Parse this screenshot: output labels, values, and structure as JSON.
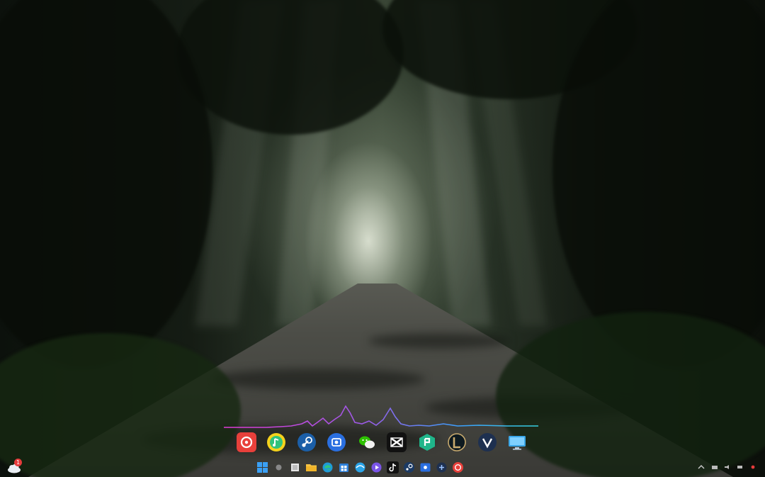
{
  "wallpaper": {
    "scene": "forest-road-with-sunbeams"
  },
  "audio_visualizer": {
    "gradient_colors": [
      "#e03bd6",
      "#9b5ae6",
      "#3aa0ff",
      "#36d0e0"
    ]
  },
  "dock": {
    "apps": [
      {
        "name": "netease-cloud-music",
        "icon": "netease-music-icon",
        "color": "#e8403b"
      },
      {
        "name": "qq-music",
        "icon": "qq-music-icon",
        "color": "#f5d21c"
      },
      {
        "name": "steam",
        "icon": "steam-icon",
        "color": "#1b5fa8"
      },
      {
        "name": "screen-capture",
        "icon": "screen-capture-icon",
        "color": "#2a6fe0"
      },
      {
        "name": "wechat",
        "icon": "wechat-icon",
        "color": "#2dc100"
      },
      {
        "name": "capcut",
        "icon": "capcut-icon",
        "color": "#111111"
      },
      {
        "name": "green-app",
        "icon": "green-app-icon",
        "color": "#1fb58a"
      },
      {
        "name": "league-of-legends",
        "icon": "league-of-legends-icon",
        "color": "#c8aa6e"
      },
      {
        "name": "vpn",
        "icon": "vpn-icon",
        "color": "#1e3050"
      },
      {
        "name": "monitor",
        "icon": "monitor-icon",
        "color": "#3aa7e8"
      }
    ]
  },
  "taskbar": {
    "weather_badge": "1",
    "items": [
      "start-icon",
      "search-icon",
      "task-view-icon",
      "file-explorer-icon",
      "edge-icon",
      "store-icon",
      "browser-icon",
      "video-player-icon",
      "tiktok-icon",
      "steam-icon",
      "screen-capture-icon",
      "game-icon",
      "netease-music-icon"
    ]
  }
}
